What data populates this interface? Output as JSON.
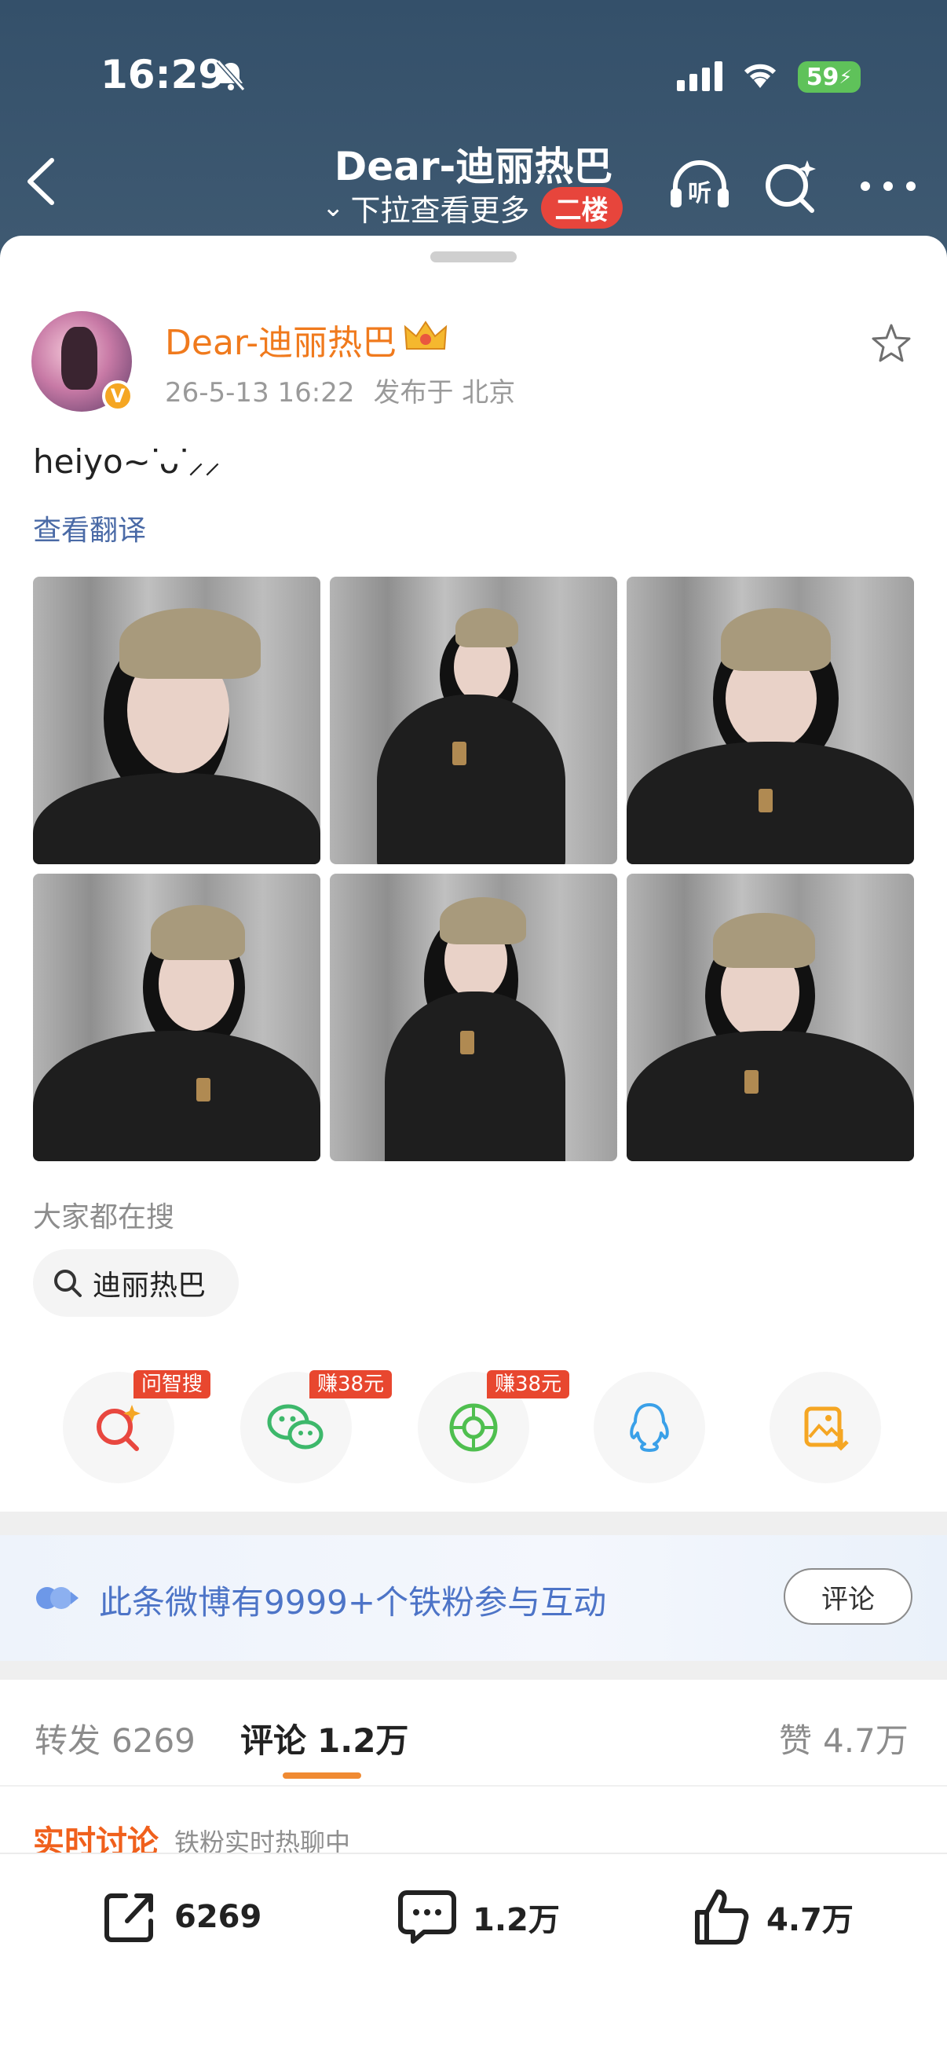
{
  "status_bar": {
    "time": "16:29",
    "battery": "59"
  },
  "nav": {
    "title": "Dear-迪丽热巴",
    "pull_hint": "下拉查看更多",
    "floor_badge": "二楼",
    "listen_icon_label": "听"
  },
  "post": {
    "author": "Dear-迪丽热巴",
    "time": "26-5-13 16:22",
    "location": "发布于 北京",
    "verified_mark": "V",
    "text": "heiyo~ᐝᴗᐝ⸝⸝",
    "translate_label": "查看翻译",
    "image_count": 6
  },
  "trending": {
    "title": "大家都在搜",
    "chip_label": "迪丽热巴"
  },
  "share": {
    "items": [
      {
        "name": "ask-search",
        "badge": "问智搜"
      },
      {
        "name": "wechat",
        "badge": "赚38元"
      },
      {
        "name": "moments",
        "badge": "赚38元"
      },
      {
        "name": "qq",
        "badge": ""
      },
      {
        "name": "save-image",
        "badge": ""
      }
    ]
  },
  "fans_banner": {
    "text": "此条微博有9999+个铁粉参与互动",
    "button": "评论"
  },
  "tabs": {
    "repost_label": "转发",
    "repost_count": "6269",
    "comment_label": "评论",
    "comment_count": "1.2万",
    "like_label": "赞",
    "like_count": "4.7万"
  },
  "live": {
    "title": "实时讨论",
    "subtitle": "铁粉实时热聊中"
  },
  "bottom_bar": {
    "repost": "6269",
    "comment": "1.2万",
    "like": "4.7万"
  },
  "colors": {
    "header_bg": "#3f5a72",
    "author": "#f07a1d",
    "link": "#4a6aa6",
    "badge_red": "#e8472f",
    "fans_text": "#4d74c7",
    "tab_underline": "#f08a32"
  }
}
